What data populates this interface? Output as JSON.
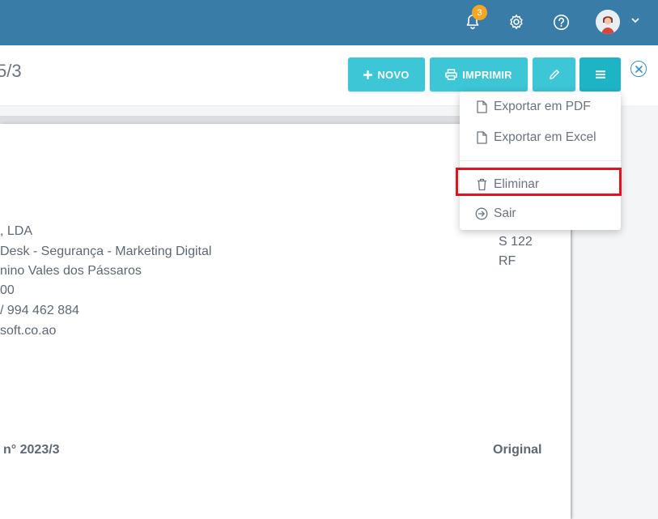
{
  "topbar": {
    "notification_count": "3",
    "icons": [
      "bell-icon",
      "gear-icon",
      "help-icon",
      "avatar",
      "chevron-down-icon"
    ],
    "color": "#3a7ca8"
  },
  "header": {
    "title": "5/3",
    "buttons": {
      "novo": "NOVO",
      "imprimir": "IMPRIMIR"
    },
    "accent": "#3cc6d6"
  },
  "dropdown": {
    "items": [
      {
        "label": "Exportar em PDF",
        "icon": "file-icon"
      },
      {
        "label": "Exportar em Excel",
        "icon": "file-icon"
      },
      {
        "label": "Eliminar",
        "icon": "trash-icon"
      },
      {
        "label": "Sair",
        "icon": "exit-icon"
      }
    ],
    "highlight_color": "#e3121e"
  },
  "document": {
    "company_lines": [
      ", LDA",
      "Desk - Segurança - Marketing Digital",
      "nino Vales dos Pássaros",
      "00",
      "/ 994 462 884",
      "soft.co.ao"
    ],
    "right_lines": [
      "S 122",
      "RF"
    ],
    "doc_number": "n° 2023/3",
    "copy_label": "Original"
  }
}
